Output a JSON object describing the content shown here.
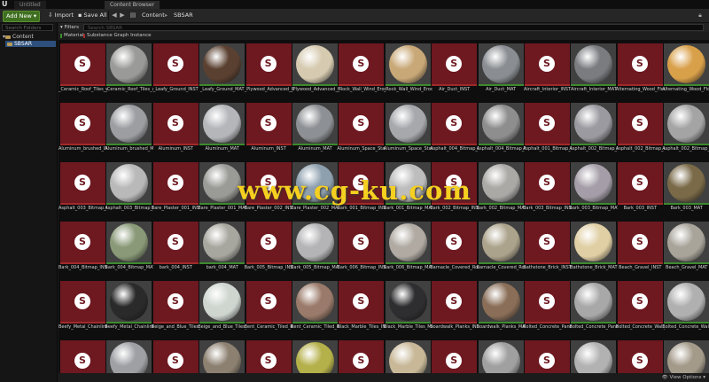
{
  "window": {
    "tabs": [
      "Untitled",
      "Content Browser"
    ],
    "logo": "U"
  },
  "toolbar": {
    "add_new": "Add New",
    "import": "Import",
    "save_all": "Save All",
    "breadcrumb": [
      "Content",
      "SBSAR"
    ]
  },
  "sidebar": {
    "search_placeholder": "Search Folders",
    "root": "Content",
    "child": "SBSAR"
  },
  "filter": {
    "filters_label": "Filters",
    "search_placeholder": "Search SBSAR",
    "chips": [
      {
        "label": "Material",
        "color": "#3d8a2e"
      },
      {
        "label": "Substance Graph Instance",
        "color": "#a12a2a"
      }
    ]
  },
  "assets": [
    {
      "label": "_Ceramic_Roof_Tiles_with_Moss_INST",
      "type": "sbsar"
    },
    {
      "label": "_Ceramic_Roof_Tiles_with_Moss_MAT",
      "type": "mat",
      "c": "#9a9a98"
    },
    {
      "label": "_Leafy_Ground_INST",
      "type": "sbsar"
    },
    {
      "label": "_Leafy_Ground_MAT",
      "type": "mat",
      "c": "#5a4030"
    },
    {
      "label": "_Plywood_Advanced_INST",
      "type": "sbsar"
    },
    {
      "label": "_Plywood_Advanced_MAT",
      "type": "mat",
      "c": "#d6cab0"
    },
    {
      "label": "_Rock_Wall_Wind_Eroded_INST",
      "type": "sbsar"
    },
    {
      "label": "_Rock_Wall_Wind_Eroded_MAT",
      "type": "mat",
      "c": "#c9a877"
    },
    {
      "label": "Air_Duct_INST",
      "type": "sbsar"
    },
    {
      "label": "Air_Duct_MAT",
      "type": "mat",
      "c": "#8a8e92"
    },
    {
      "label": "Aircraft_Interior_INST",
      "type": "sbsar"
    },
    {
      "label": "Aircraft_Interior_MAT",
      "type": "mat",
      "c": "#7a7c80"
    },
    {
      "label": "Alternating_Wood_Floor_INST",
      "type": "sbsar"
    },
    {
      "label": "Alternating_Wood_Floor_MAT",
      "type": "mat",
      "c": "#d9a04a"
    },
    {
      "label": "Aluminum_brushed_INST",
      "type": "sbsar"
    },
    {
      "label": "Aluminum_brushed_MAT",
      "type": "mat",
      "c": "#9c9ea2"
    },
    {
      "label": "Aluminum_INST",
      "type": "sbsar"
    },
    {
      "label": "Aluminum_MAT",
      "type": "mat",
      "c": "#b4b6ba"
    },
    {
      "label": "Aluminum_INST",
      "type": "sbsar"
    },
    {
      "label": "Aluminum_MAT",
      "type": "mat",
      "c": "#8d9094"
    },
    {
      "label": "Aluminum_Space_Station_INST",
      "type": "sbsar"
    },
    {
      "label": "Aluminum_Space_Station_MAT",
      "type": "mat",
      "c": "#a6a8ac"
    },
    {
      "label": "Asphalt_004_Bitmap_INST",
      "type": "sbsar"
    },
    {
      "label": "Asphalt_004_Bitmap_MAT",
      "type": "mat",
      "c": "#8e8e8e"
    },
    {
      "label": "Asphalt_001_Bitmap_INST",
      "type": "sbsar"
    },
    {
      "label": "Asphalt_002_Bitmap_MAT",
      "type": "mat",
      "c": "#9a9aa0"
    },
    {
      "label": "Asphalt_002_Bitmap_INST",
      "type": "sbsar"
    },
    {
      "label": "Asphalt_002_Bitmap_MAT",
      "type": "mat",
      "c": "#a4a4a4"
    },
    {
      "label": "Asphalt_003_Bitmap_INST",
      "type": "sbsar"
    },
    {
      "label": "Asphalt_003_Bitmap_MAT",
      "type": "mat",
      "c": "#b9b9b9"
    },
    {
      "label": "Bare_Plaster_001_INST",
      "type": "sbsar"
    },
    {
      "label": "Bare_Plaster_001_MAT",
      "type": "mat",
      "c": "#9a9a96"
    },
    {
      "label": "Bare_Plaster_002_INST",
      "type": "sbsar"
    },
    {
      "label": "Bare_Plaster_002_MAT",
      "type": "mat",
      "c": "#8ea0ae"
    },
    {
      "label": "Bark_001_Bitmap_INST",
      "type": "sbsar"
    },
    {
      "label": "Bark_001_Bitmap_MAT",
      "type": "mat",
      "c": "#bdbdbd"
    },
    {
      "label": "Bark_002_Bitmap_INST",
      "type": "sbsar"
    },
    {
      "label": "Bark_002_Bitmap_MAT",
      "type": "mat",
      "c": "#aaa9a6"
    },
    {
      "label": "Bark_003_Bitmap_INST",
      "type": "sbsar"
    },
    {
      "label": "Bark_003_Bitmap_MAT",
      "type": "mat",
      "c": "#a59ea8"
    },
    {
      "label": "Bark_003_INST",
      "type": "sbsar"
    },
    {
      "label": "Bark_003_MAT",
      "type": "mat",
      "c": "#7a6a48"
    },
    {
      "label": "Bark_004_Bitmap_INST",
      "type": "sbsar"
    },
    {
      "label": "Bark_004_Bitmap_MAT",
      "type": "mat",
      "c": "#8a9a78"
    },
    {
      "label": "bark_004_INST",
      "type": "sbsar"
    },
    {
      "label": "bark_004_MAT",
      "type": "mat",
      "c": "#a8a79f"
    },
    {
      "label": "Bark_005_Bitmap_INST",
      "type": "sbsar"
    },
    {
      "label": "Bark_005_Bitmap_MAT",
      "type": "mat",
      "c": "#b4b4b6"
    },
    {
      "label": "Bark_006_Bitmap_INST",
      "type": "sbsar"
    },
    {
      "label": "Bark_006_Bitmap_MAT",
      "type": "mat",
      "c": "#b0aaa2"
    },
    {
      "label": "Barnacle_Covered_Rock_INST",
      "type": "sbsar"
    },
    {
      "label": "Barnacle_Covered_Rock_MAT",
      "type": "mat",
      "c": "#aca38c"
    },
    {
      "label": "Bathstone_Brick_INST",
      "type": "sbsar"
    },
    {
      "label": "Bathstone_Brick_MAT",
      "type": "mat",
      "c": "#e0cfa4"
    },
    {
      "label": "Beach_Gravel_INST",
      "type": "sbsar"
    },
    {
      "label": "Beach_Gravel_MAT",
      "type": "mat",
      "c": "#a8a49a"
    },
    {
      "label": "Beefy_Metal_Chainlink_INST",
      "type": "sbsar"
    },
    {
      "label": "Beefy_Metal_Chainlink_MAT",
      "type": "mat",
      "c": "#2a2a2a"
    },
    {
      "label": "Beige_and_Blue_Tiles_INST",
      "type": "sbsar"
    },
    {
      "label": "Beige_and_Blue_Tiles_MAT",
      "type": "mat",
      "c": "#cfd6d0"
    },
    {
      "label": "Bent_Ceramic_Tiled_Roof_INST",
      "type": "sbsar"
    },
    {
      "label": "Bent_Ceramic_Tiled_Roof_MAT",
      "type": "mat",
      "c": "#9a7a6a"
    },
    {
      "label": "Black_Marble_Tiles_INST",
      "type": "sbsar"
    },
    {
      "label": "Black_Marble_Tiles_MAT",
      "type": "mat",
      "c": "#2e2e30"
    },
    {
      "label": "Boardwalk_Planks_INST",
      "type": "sbsar"
    },
    {
      "label": "Boardwalk_Planks_MAT",
      "type": "mat",
      "c": "#8a6e58"
    },
    {
      "label": "Bolted_Concrete_Panels_INST",
      "type": "sbsar"
    },
    {
      "label": "Bolted_Concrete_Panels_MAT",
      "type": "mat",
      "c": "#a8a8a8"
    },
    {
      "label": "Bolted_Concrete_Wall_INST",
      "type": "sbsar"
    },
    {
      "label": "Bolted_Concrete_Wall_MAT",
      "type": "mat",
      "c": "#b0b0b0"
    },
    {
      "label": "",
      "type": "sbsar"
    },
    {
      "label": "",
      "type": "mat",
      "c": "#9ea0a4"
    },
    {
      "label": "",
      "type": "sbsar"
    },
    {
      "label": "",
      "type": "mat",
      "c": "#8c8070"
    },
    {
      "label": "",
      "type": "sbsar"
    },
    {
      "label": "",
      "type": "mat",
      "c": "#b4b04a"
    },
    {
      "label": "",
      "type": "sbsar"
    },
    {
      "label": "",
      "type": "mat",
      "c": "#c8b898"
    },
    {
      "label": "",
      "type": "sbsar"
    },
    {
      "label": "",
      "type": "mat",
      "c": "#a0a0a0"
    },
    {
      "label": "",
      "type": "sbsar"
    },
    {
      "label": "",
      "type": "mat",
      "c": "#b2b2b2"
    },
    {
      "label": "",
      "type": "sbsar"
    },
    {
      "label": "",
      "type": "mat",
      "c": "#a49a8a"
    }
  ],
  "watermark": "www.cg-ku.com",
  "status": {
    "items_text": "",
    "view_options": "View Options"
  }
}
